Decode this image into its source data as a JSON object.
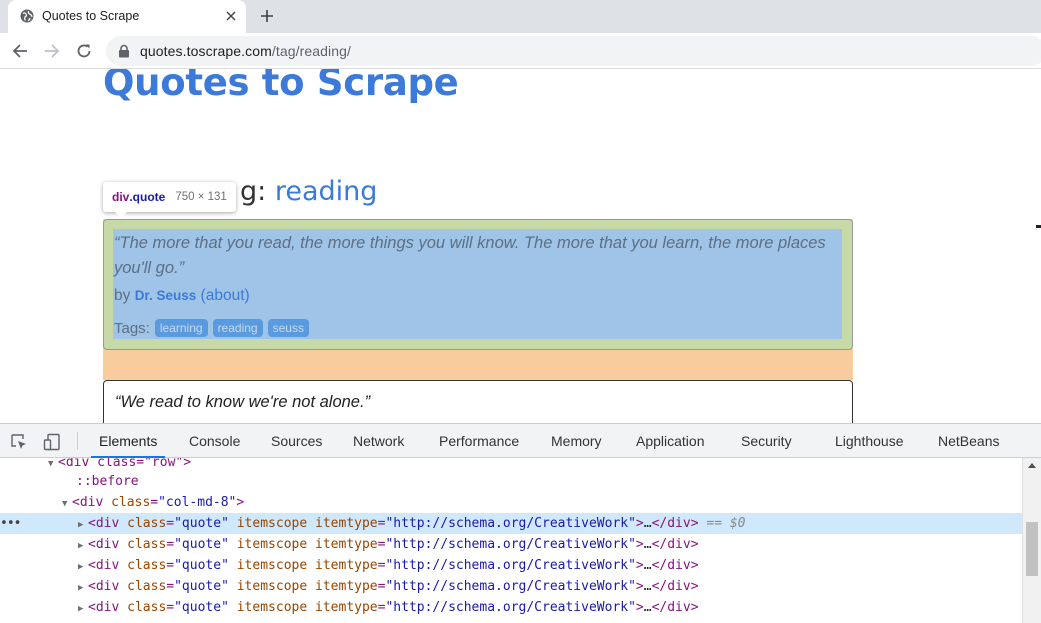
{
  "browser": {
    "tab": {
      "title": "Quotes to Scrape",
      "favicon": "globe-icon",
      "close": "close-icon"
    },
    "new_tab": "plus-icon",
    "nav": {
      "back": "back-arrow-icon",
      "forward": "forward-arrow-icon",
      "reload": "reload-icon"
    },
    "url": {
      "host": "quotes.toscrape.com",
      "path": "/tag/reading/"
    }
  },
  "page": {
    "site_title": "Quotes to Scrape",
    "viewing_prefix": "g:",
    "viewing_tag": "reading",
    "inspector_tooltip": {
      "tag": "div",
      "class": ".quote",
      "size": "750 × 131"
    },
    "quotes": [
      {
        "text": "“The more that you read, the more things you will know. The more that you learn, the more places you'll go.”",
        "by": "by",
        "author": "Dr. Seuss",
        "about": "(about)",
        "tags_label": "Tags:",
        "tags": [
          "learning",
          "reading",
          "seuss"
        ]
      },
      {
        "text": "“We read to know we're not alone.”"
      }
    ]
  },
  "devtools": {
    "tabs": [
      "Elements",
      "Console",
      "Sources",
      "Network",
      "Performance",
      "Memory",
      "Application",
      "Security",
      "Lighthouse",
      "NetBeans"
    ],
    "active_tab": "Elements",
    "tools": {
      "inspect": "inspect-element-icon",
      "device": "device-toolbar-icon"
    },
    "dom": {
      "row_line": "<div class=\"row\">",
      "before": "::before",
      "col_tag": "div",
      "col_attr": "class",
      "col_val": "\"col-md-8\"",
      "quote_tag": "div",
      "quote_class_attr": "class",
      "quote_class_val": "\"quote\"",
      "quote_itemscope": "itemscope",
      "quote_itemtype_attr": "itemtype",
      "quote_itemtype_val": "\"http://schema.org/CreativeWork\"",
      "ellipsis": "…",
      "close_tag": "</div>",
      "selected_marker": "== $0",
      "dots": "•••"
    }
  },
  "colors": {
    "accent": "#3b7ad9",
    "highlight_content": "#9fc4e7",
    "highlight_padding": "#c7d9a7",
    "highlight_margin": "#f9cc9d",
    "selected_row": "#cfe8fc"
  }
}
